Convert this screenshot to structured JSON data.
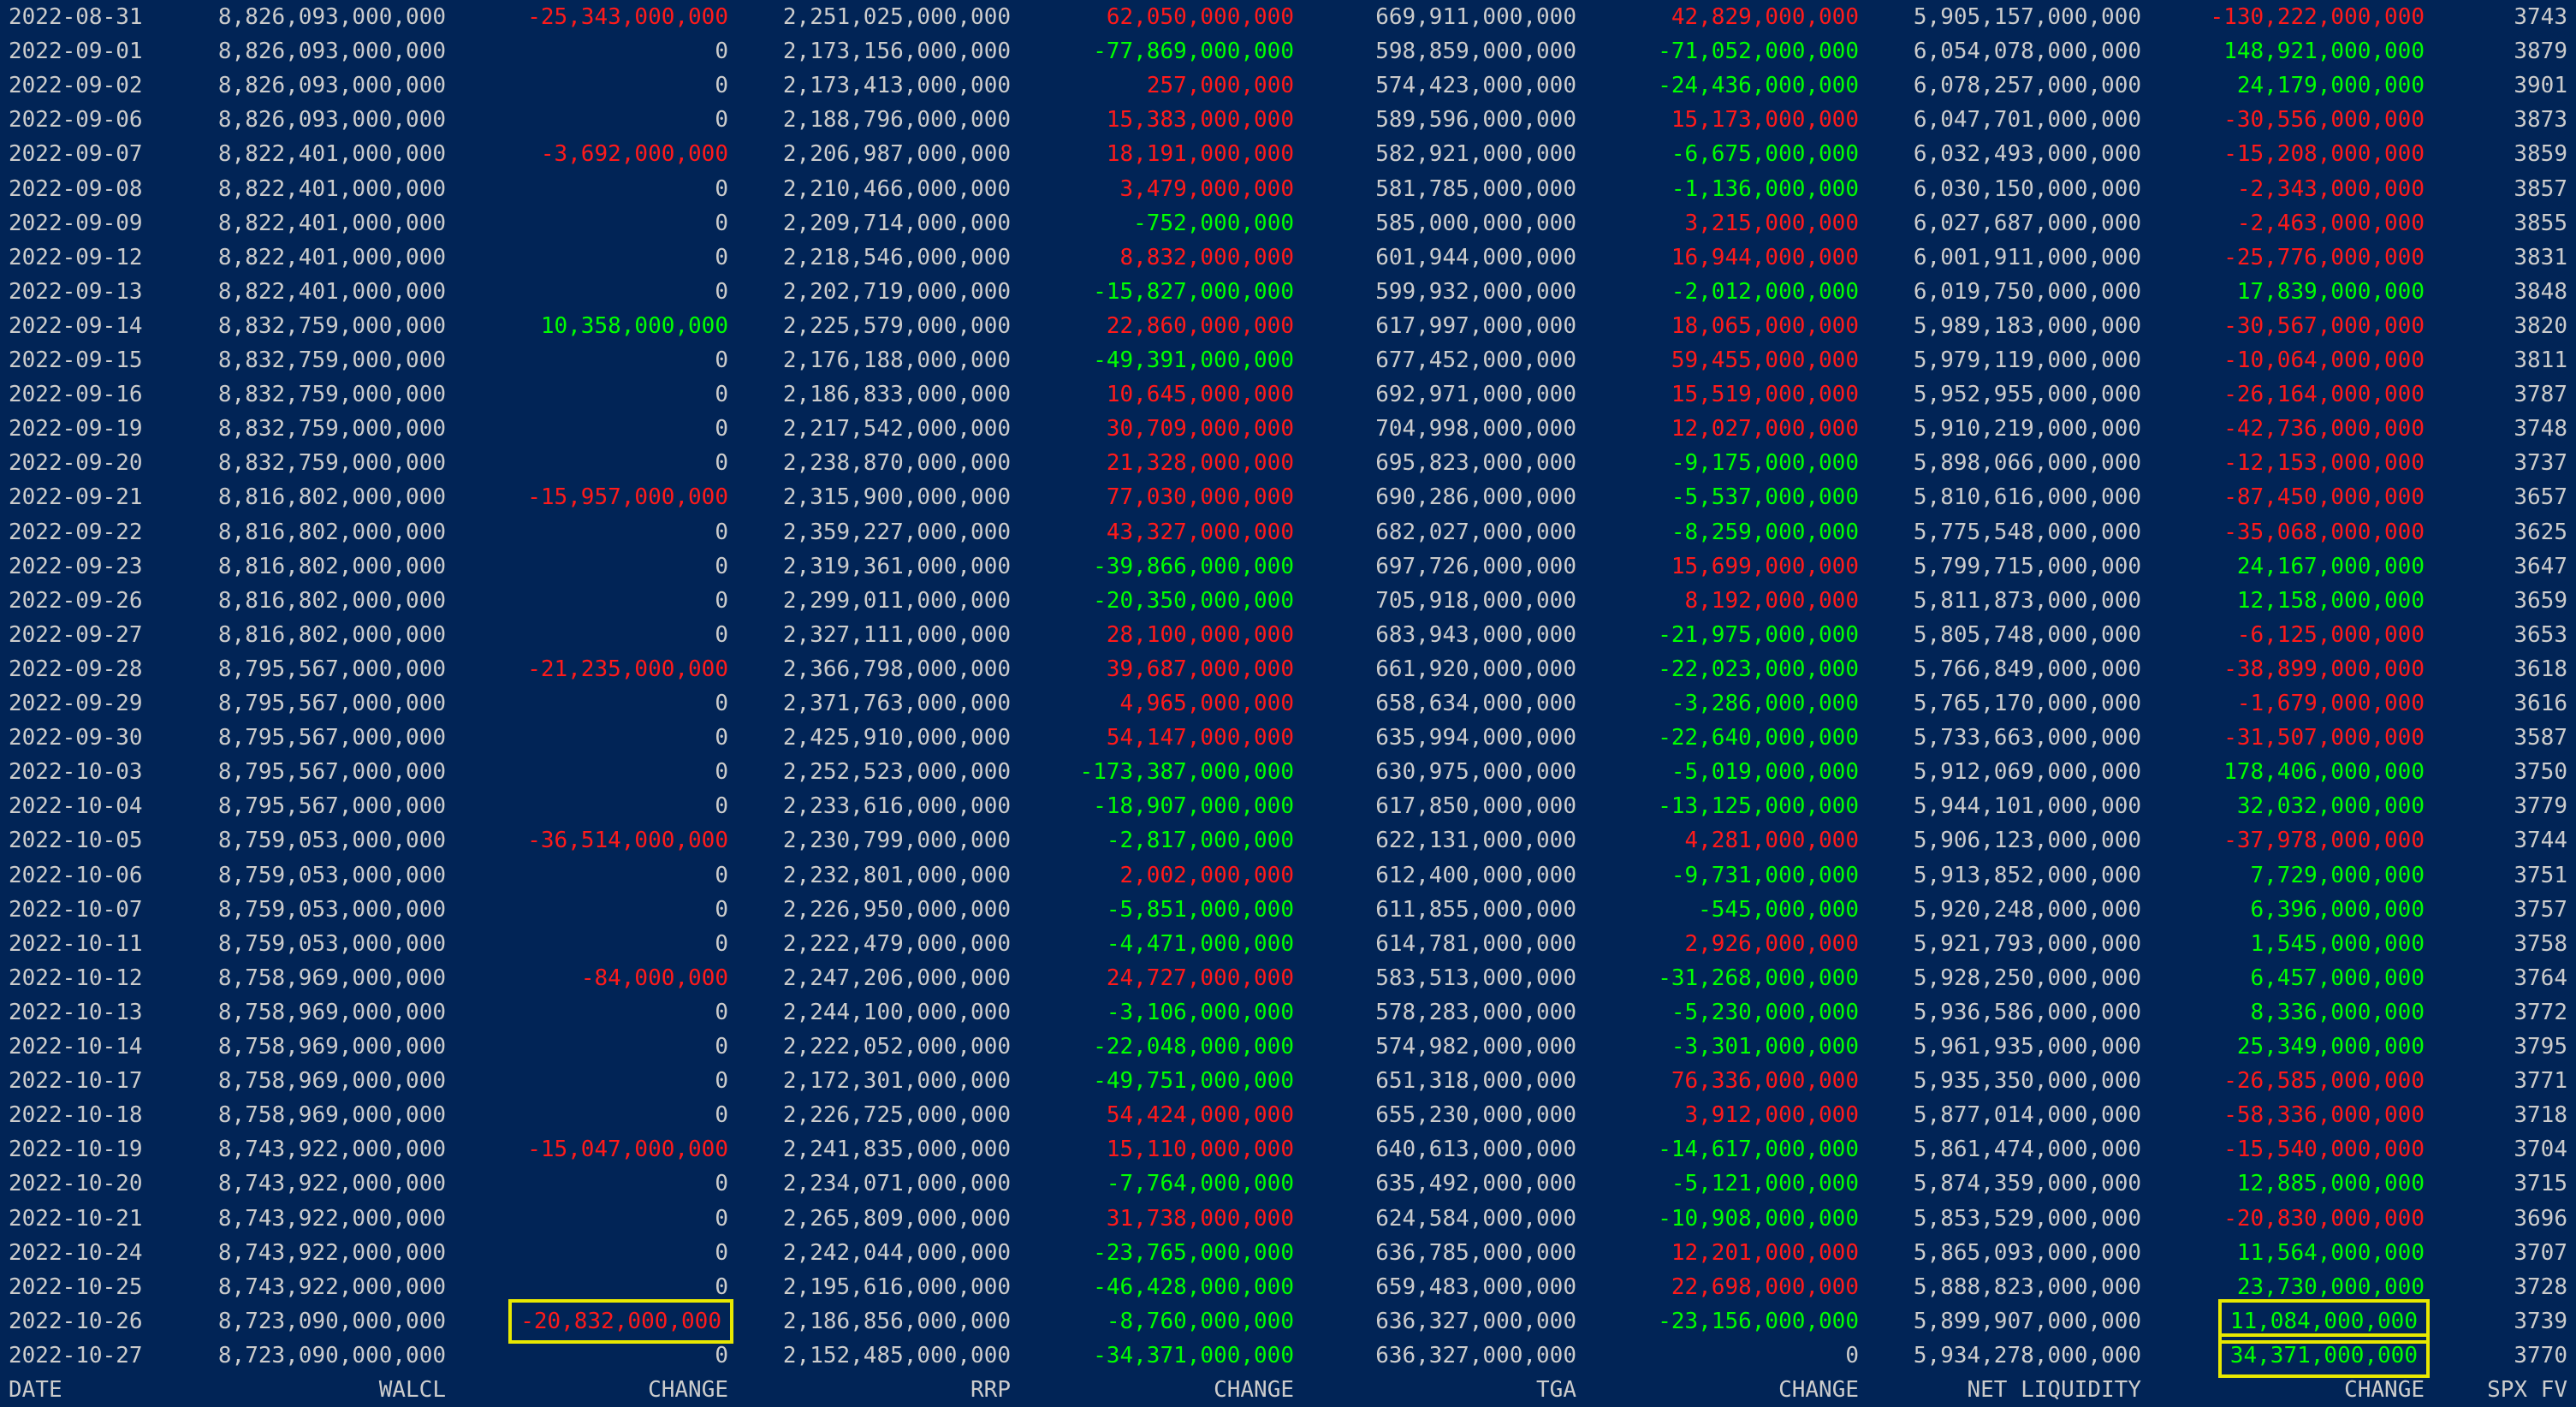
{
  "headers": {
    "date": "DATE",
    "walcl": "WALCL",
    "walcl_change": "CHANGE",
    "rrp": "RRP",
    "rrp_change": "CHANGE",
    "tga": "TGA",
    "tga_change": "CHANGE",
    "net_liquidity": "NET LIQUIDITY",
    "nl_change": "CHANGE",
    "spx_fv": "SPX FV"
  },
  "colors": {
    "background": "#012456",
    "text": "#cccccc",
    "positive": "#00ff00",
    "negative": "#ff1a1a",
    "highlight_box": "#e8e800"
  },
  "rows": [
    [
      "2022-08-31",
      "8,826,093,000,000",
      "-25,343,000,000",
      "2,251,025,000,000",
      "62,050,000,000",
      "669,911,000,000",
      "42,829,000,000",
      "5,905,157,000,000",
      "-130,222,000,000",
      "3743"
    ],
    [
      "2022-09-01",
      "8,826,093,000,000",
      "0",
      "2,173,156,000,000",
      "-77,869,000,000",
      "598,859,000,000",
      "-71,052,000,000",
      "6,054,078,000,000",
      "148,921,000,000",
      "3879"
    ],
    [
      "2022-09-02",
      "8,826,093,000,000",
      "0",
      "2,173,413,000,000",
      "257,000,000",
      "574,423,000,000",
      "-24,436,000,000",
      "6,078,257,000,000",
      "24,179,000,000",
      "3901"
    ],
    [
      "2022-09-06",
      "8,826,093,000,000",
      "0",
      "2,188,796,000,000",
      "15,383,000,000",
      "589,596,000,000",
      "15,173,000,000",
      "6,047,701,000,000",
      "-30,556,000,000",
      "3873"
    ],
    [
      "2022-09-07",
      "8,822,401,000,000",
      "-3,692,000,000",
      "2,206,987,000,000",
      "18,191,000,000",
      "582,921,000,000",
      "-6,675,000,000",
      "6,032,493,000,000",
      "-15,208,000,000",
      "3859"
    ],
    [
      "2022-09-08",
      "8,822,401,000,000",
      "0",
      "2,210,466,000,000",
      "3,479,000,000",
      "581,785,000,000",
      "-1,136,000,000",
      "6,030,150,000,000",
      "-2,343,000,000",
      "3857"
    ],
    [
      "2022-09-09",
      "8,822,401,000,000",
      "0",
      "2,209,714,000,000",
      "-752,000,000",
      "585,000,000,000",
      "3,215,000,000",
      "6,027,687,000,000",
      "-2,463,000,000",
      "3855"
    ],
    [
      "2022-09-12",
      "8,822,401,000,000",
      "0",
      "2,218,546,000,000",
      "8,832,000,000",
      "601,944,000,000",
      "16,944,000,000",
      "6,001,911,000,000",
      "-25,776,000,000",
      "3831"
    ],
    [
      "2022-09-13",
      "8,822,401,000,000",
      "0",
      "2,202,719,000,000",
      "-15,827,000,000",
      "599,932,000,000",
      "-2,012,000,000",
      "6,019,750,000,000",
      "17,839,000,000",
      "3848"
    ],
    [
      "2022-09-14",
      "8,832,759,000,000",
      "10,358,000,000",
      "2,225,579,000,000",
      "22,860,000,000",
      "617,997,000,000",
      "18,065,000,000",
      "5,989,183,000,000",
      "-30,567,000,000",
      "3820"
    ],
    [
      "2022-09-15",
      "8,832,759,000,000",
      "0",
      "2,176,188,000,000",
      "-49,391,000,000",
      "677,452,000,000",
      "59,455,000,000",
      "5,979,119,000,000",
      "-10,064,000,000",
      "3811"
    ],
    [
      "2022-09-16",
      "8,832,759,000,000",
      "0",
      "2,186,833,000,000",
      "10,645,000,000",
      "692,971,000,000",
      "15,519,000,000",
      "5,952,955,000,000",
      "-26,164,000,000",
      "3787"
    ],
    [
      "2022-09-19",
      "8,832,759,000,000",
      "0",
      "2,217,542,000,000",
      "30,709,000,000",
      "704,998,000,000",
      "12,027,000,000",
      "5,910,219,000,000",
      "-42,736,000,000",
      "3748"
    ],
    [
      "2022-09-20",
      "8,832,759,000,000",
      "0",
      "2,238,870,000,000",
      "21,328,000,000",
      "695,823,000,000",
      "-9,175,000,000",
      "5,898,066,000,000",
      "-12,153,000,000",
      "3737"
    ],
    [
      "2022-09-21",
      "8,816,802,000,000",
      "-15,957,000,000",
      "2,315,900,000,000",
      "77,030,000,000",
      "690,286,000,000",
      "-5,537,000,000",
      "5,810,616,000,000",
      "-87,450,000,000",
      "3657"
    ],
    [
      "2022-09-22",
      "8,816,802,000,000",
      "0",
      "2,359,227,000,000",
      "43,327,000,000",
      "682,027,000,000",
      "-8,259,000,000",
      "5,775,548,000,000",
      "-35,068,000,000",
      "3625"
    ],
    [
      "2022-09-23",
      "8,816,802,000,000",
      "0",
      "2,319,361,000,000",
      "-39,866,000,000",
      "697,726,000,000",
      "15,699,000,000",
      "5,799,715,000,000",
      "24,167,000,000",
      "3647"
    ],
    [
      "2022-09-26",
      "8,816,802,000,000",
      "0",
      "2,299,011,000,000",
      "-20,350,000,000",
      "705,918,000,000",
      "8,192,000,000",
      "5,811,873,000,000",
      "12,158,000,000",
      "3659"
    ],
    [
      "2022-09-27",
      "8,816,802,000,000",
      "0",
      "2,327,111,000,000",
      "28,100,000,000",
      "683,943,000,000",
      "-21,975,000,000",
      "5,805,748,000,000",
      "-6,125,000,000",
      "3653"
    ],
    [
      "2022-09-28",
      "8,795,567,000,000",
      "-21,235,000,000",
      "2,366,798,000,000",
      "39,687,000,000",
      "661,920,000,000",
      "-22,023,000,000",
      "5,766,849,000,000",
      "-38,899,000,000",
      "3618"
    ],
    [
      "2022-09-29",
      "8,795,567,000,000",
      "0",
      "2,371,763,000,000",
      "4,965,000,000",
      "658,634,000,000",
      "-3,286,000,000",
      "5,765,170,000,000",
      "-1,679,000,000",
      "3616"
    ],
    [
      "2022-09-30",
      "8,795,567,000,000",
      "0",
      "2,425,910,000,000",
      "54,147,000,000",
      "635,994,000,000",
      "-22,640,000,000",
      "5,733,663,000,000",
      "-31,507,000,000",
      "3587"
    ],
    [
      "2022-10-03",
      "8,795,567,000,000",
      "0",
      "2,252,523,000,000",
      "-173,387,000,000",
      "630,975,000,000",
      "-5,019,000,000",
      "5,912,069,000,000",
      "178,406,000,000",
      "3750"
    ],
    [
      "2022-10-04",
      "8,795,567,000,000",
      "0",
      "2,233,616,000,000",
      "-18,907,000,000",
      "617,850,000,000",
      "-13,125,000,000",
      "5,944,101,000,000",
      "32,032,000,000",
      "3779"
    ],
    [
      "2022-10-05",
      "8,759,053,000,000",
      "-36,514,000,000",
      "2,230,799,000,000",
      "-2,817,000,000",
      "622,131,000,000",
      "4,281,000,000",
      "5,906,123,000,000",
      "-37,978,000,000",
      "3744"
    ],
    [
      "2022-10-06",
      "8,759,053,000,000",
      "0",
      "2,232,801,000,000",
      "2,002,000,000",
      "612,400,000,000",
      "-9,731,000,000",
      "5,913,852,000,000",
      "7,729,000,000",
      "3751"
    ],
    [
      "2022-10-07",
      "8,759,053,000,000",
      "0",
      "2,226,950,000,000",
      "-5,851,000,000",
      "611,855,000,000",
      "-545,000,000",
      "5,920,248,000,000",
      "6,396,000,000",
      "3757"
    ],
    [
      "2022-10-11",
      "8,759,053,000,000",
      "0",
      "2,222,479,000,000",
      "-4,471,000,000",
      "614,781,000,000",
      "2,926,000,000",
      "5,921,793,000,000",
      "1,545,000,000",
      "3758"
    ],
    [
      "2022-10-12",
      "8,758,969,000,000",
      "-84,000,000",
      "2,247,206,000,000",
      "24,727,000,000",
      "583,513,000,000",
      "-31,268,000,000",
      "5,928,250,000,000",
      "6,457,000,000",
      "3764"
    ],
    [
      "2022-10-13",
      "8,758,969,000,000",
      "0",
      "2,244,100,000,000",
      "-3,106,000,000",
      "578,283,000,000",
      "-5,230,000,000",
      "5,936,586,000,000",
      "8,336,000,000",
      "3772"
    ],
    [
      "2022-10-14",
      "8,758,969,000,000",
      "0",
      "2,222,052,000,000",
      "-22,048,000,000",
      "574,982,000,000",
      "-3,301,000,000",
      "5,961,935,000,000",
      "25,349,000,000",
      "3795"
    ],
    [
      "2022-10-17",
      "8,758,969,000,000",
      "0",
      "2,172,301,000,000",
      "-49,751,000,000",
      "651,318,000,000",
      "76,336,000,000",
      "5,935,350,000,000",
      "-26,585,000,000",
      "3771"
    ],
    [
      "2022-10-18",
      "8,758,969,000,000",
      "0",
      "2,226,725,000,000",
      "54,424,000,000",
      "655,230,000,000",
      "3,912,000,000",
      "5,877,014,000,000",
      "-58,336,000,000",
      "3718"
    ],
    [
      "2022-10-19",
      "8,743,922,000,000",
      "-15,047,000,000",
      "2,241,835,000,000",
      "15,110,000,000",
      "640,613,000,000",
      "-14,617,000,000",
      "5,861,474,000,000",
      "-15,540,000,000",
      "3704"
    ],
    [
      "2022-10-20",
      "8,743,922,000,000",
      "0",
      "2,234,071,000,000",
      "-7,764,000,000",
      "635,492,000,000",
      "-5,121,000,000",
      "5,874,359,000,000",
      "12,885,000,000",
      "3715"
    ],
    [
      "2022-10-21",
      "8,743,922,000,000",
      "0",
      "2,265,809,000,000",
      "31,738,000,000",
      "624,584,000,000",
      "-10,908,000,000",
      "5,853,529,000,000",
      "-20,830,000,000",
      "3696"
    ],
    [
      "2022-10-24",
      "8,743,922,000,000",
      "0",
      "2,242,044,000,000",
      "-23,765,000,000",
      "636,785,000,000",
      "12,201,000,000",
      "5,865,093,000,000",
      "11,564,000,000",
      "3707"
    ],
    [
      "2022-10-25",
      "8,743,922,000,000",
      "0",
      "2,195,616,000,000",
      "-46,428,000,000",
      "659,483,000,000",
      "22,698,000,000",
      "5,888,823,000,000",
      "23,730,000,000",
      "3728"
    ],
    [
      "2022-10-26",
      "8,723,090,000,000",
      "-20,832,000,000",
      "2,186,856,000,000",
      "-8,760,000,000",
      "636,327,000,000",
      "-23,156,000,000",
      "5,899,907,000,000",
      "11,084,000,000",
      "3739"
    ],
    [
      "2022-10-27",
      "8,723,090,000,000",
      "0",
      "2,152,485,000,000",
      "-34,371,000,000",
      "636,327,000,000",
      "0",
      "5,934,278,000,000",
      "34,371,000,000",
      "3770"
    ]
  ],
  "highlighted_cells": [
    {
      "row": 38,
      "col": 2
    },
    {
      "row": 38,
      "col": 8
    },
    {
      "row": 39,
      "col": 8
    }
  ]
}
